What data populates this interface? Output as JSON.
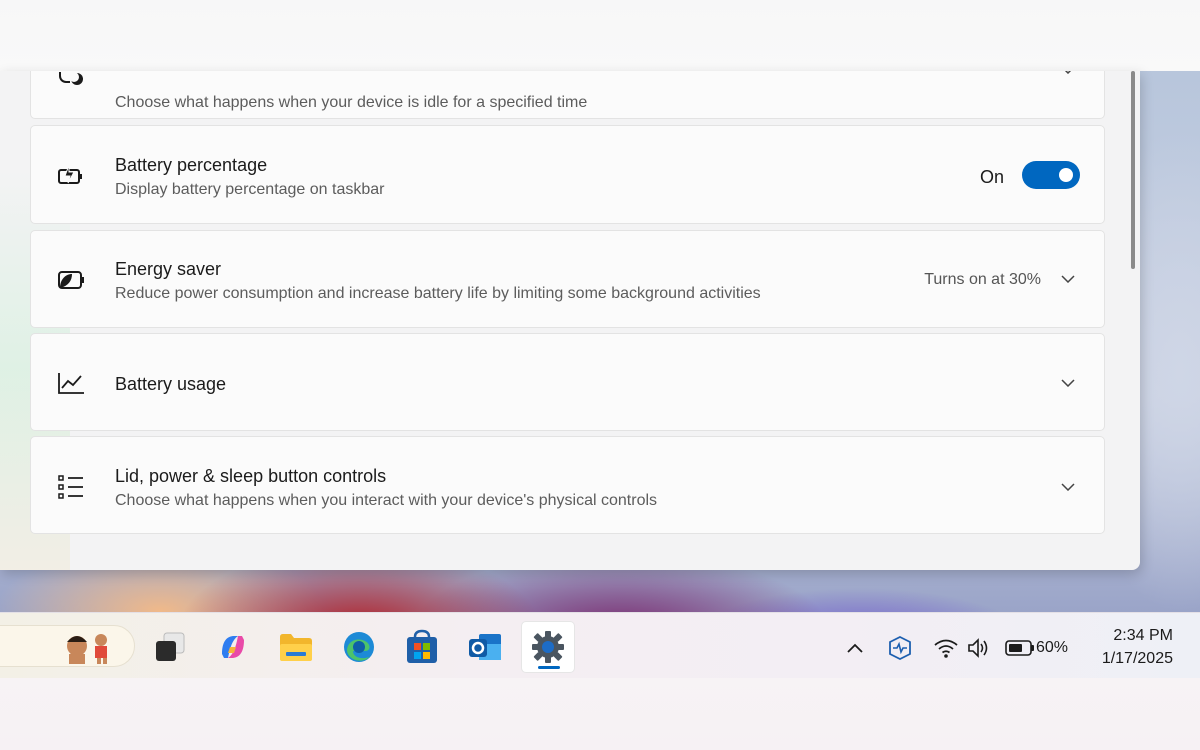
{
  "cards": {
    "screen_sleep": {
      "subtitle": "Choose what happens when your device is idle for a specified time"
    },
    "battery_percentage": {
      "title": "Battery percentage",
      "subtitle": "Display battery percentage on taskbar",
      "toggle_label": "On",
      "toggle_state": true
    },
    "energy_saver": {
      "title": "Energy saver",
      "subtitle": "Reduce power consumption and increase battery life by limiting some background activities",
      "status": "Turns on at 30%"
    },
    "battery_usage": {
      "title": "Battery usage"
    },
    "lid_power": {
      "title": "Lid, power & sleep button controls",
      "subtitle": "Choose what happens when you interact with your device's physical controls"
    }
  },
  "taskbar": {
    "apps": [
      "widgets",
      "task-view",
      "copilot",
      "file-explorer",
      "edge",
      "microsoft-store",
      "outlook",
      "settings"
    ],
    "active_app": "settings",
    "battery_percent": "60%",
    "time": "2:34 PM",
    "date": "1/17/2025"
  },
  "colors": {
    "accent": "#0067c0"
  }
}
